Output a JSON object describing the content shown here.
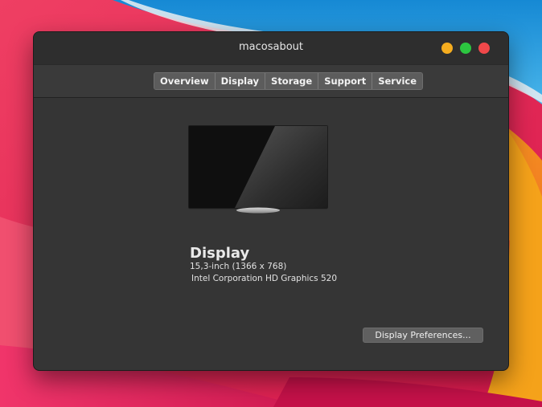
{
  "window": {
    "title": "macosabout"
  },
  "tabs": [
    {
      "label": "Overview"
    },
    {
      "label": "Display"
    },
    {
      "label": "Storage"
    },
    {
      "label": "Support"
    },
    {
      "label": "Service"
    }
  ],
  "display": {
    "heading": "Display",
    "size": "15,3-inch (1366 x 768)",
    "graphics": "Intel Corporation HD Graphics 520",
    "preferences_button": "Display Preferences..."
  },
  "colors": {
    "minimize": "#f5ad1f",
    "maximize": "#2cc640",
    "close": "#f0484a",
    "window_bg": "#353535"
  }
}
